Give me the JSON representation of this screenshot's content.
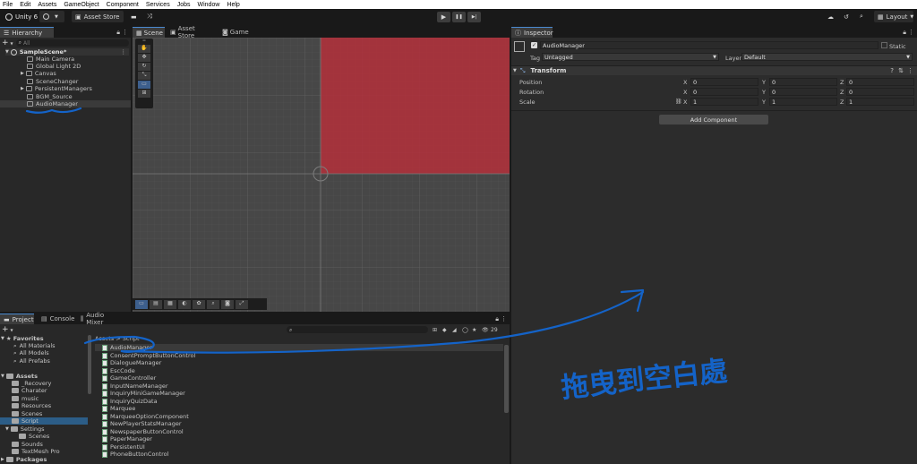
{
  "menubar": [
    "File",
    "Edit",
    "Assets",
    "GameObject",
    "Component",
    "Services",
    "Jobs",
    "Window",
    "Help"
  ],
  "toolbar": {
    "app": "Unity 6",
    "account_icon": "account-icon",
    "asset_store": "Asset Store",
    "layout": "Layout",
    "play": "▶",
    "pause": "❚❚",
    "step": "▶|"
  },
  "hierarchy": {
    "tab": "Hierarchy",
    "search_placeholder": "All",
    "scene": "SampleScene*",
    "items": [
      "Main Camera",
      "Global Light 2D",
      "Canvas",
      "SceneChanger",
      "PersistentManagers",
      "BGM_Source",
      "AudioManager"
    ]
  },
  "scene": {
    "tabs": [
      "Scene",
      "Asset Store",
      "Game"
    ]
  },
  "inspector": {
    "tab": "Inspector",
    "object_name": "AudioManager",
    "static_label": "Static",
    "tag_label": "Tag",
    "tag_value": "Untagged",
    "layer_label": "Layer",
    "layer_value": "Default",
    "component": "Transform",
    "rows": [
      {
        "label": "Position",
        "x": "0",
        "y": "0",
        "z": "0"
      },
      {
        "label": "Rotation",
        "x": "0",
        "y": "0",
        "z": "0"
      },
      {
        "label": "Scale",
        "x": "1",
        "y": "1",
        "z": "1"
      }
    ],
    "add_component": "Add Component"
  },
  "project": {
    "tabs": [
      "Project",
      "Console",
      "Audio Mixer"
    ],
    "favorites_label": "Favorites",
    "favorites": [
      "All Materials",
      "All Models",
      "All Prefabs"
    ],
    "assets_label": "Assets",
    "folders": [
      "_Recovery",
      "Charater",
      "music",
      "Resources",
      "Scenes",
      "Script",
      "Settings",
      "Scenes",
      "Sounds",
      "TextMesh Pro"
    ],
    "packages_label": "Packages",
    "breadcrumb": "Assets > Script",
    "count": "29",
    "files": [
      "AudioManager",
      "ConsentPromptButtonControl",
      "DialogueManager",
      "EscCode",
      "GameController",
      "InputNameManager",
      "InquiryMiniGameManager",
      "InquiryQuizData",
      "Marquee",
      "MarqueeOptionComponent",
      "NewPlayerStatsManager",
      "NewspaperButtonControl",
      "PaperManager",
      "PersistentUI",
      "PhoneButtonControl"
    ]
  },
  "annotation": {
    "handwritten_text": "拖曳到空白處",
    "color": "#1463c8"
  }
}
